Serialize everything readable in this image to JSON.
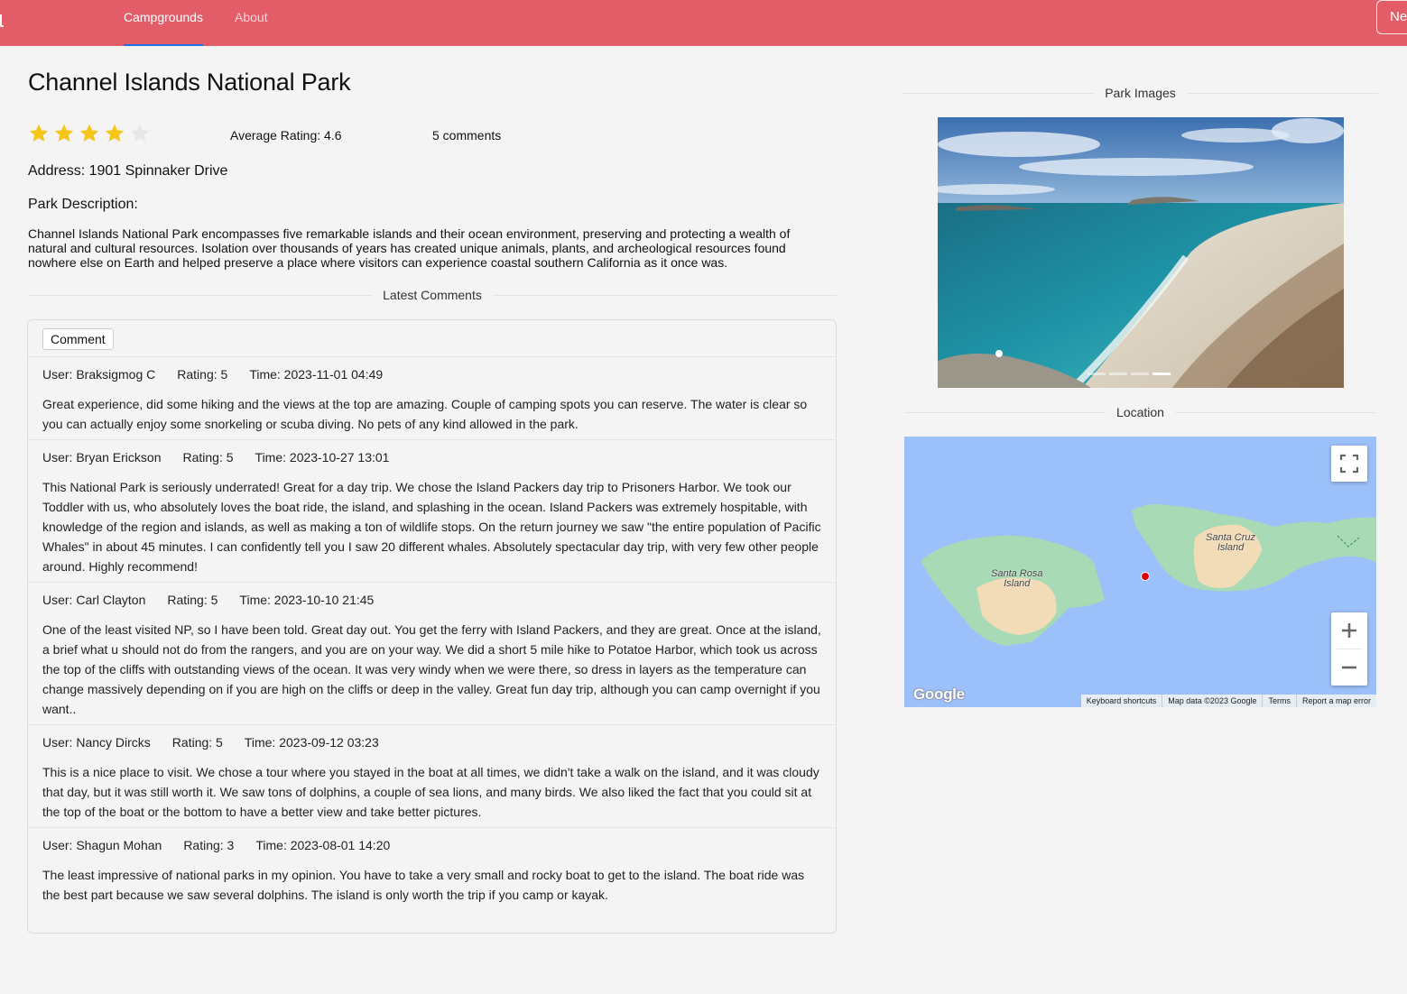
{
  "nav": {
    "tabs": [
      {
        "label": "Campgrounds",
        "active": true
      },
      {
        "label": "About",
        "active": false
      }
    ],
    "new_button": "Ne"
  },
  "park": {
    "title": "Channel Islands National Park",
    "rating_stars": {
      "filled": 4,
      "total": 5
    },
    "average_rating": "Average Rating: 4.6",
    "comment_count": "5 comments",
    "address": "Address: 1901 Spinnaker Drive",
    "description_heading": "Park Description:",
    "description": "Channel Islands National Park encompasses five remarkable islands and their ocean environment, preserving and protecting a wealth of natural and cultural resources. Isolation over thousands of years has created unique animals, plants, and archeological resources found nowhere else on Earth and helped preserve a place where visitors can experience coastal southern California as it once was."
  },
  "comments_section": {
    "heading": "Latest Comments",
    "comment_button": "Comment",
    "items": [
      {
        "user": "User: Braksigmog C",
        "rating": "Rating: 5",
        "time": "Time: 2023-11-01 04:49",
        "text": "Great experience, did some hiking and the views at the top are amazing. Couple of camping spots you can reserve. The water is clear so you can actually enjoy some snorkeling or scuba diving. No pets of any kind allowed in the park."
      },
      {
        "user": "User: Bryan Erickson",
        "rating": "Rating: 5",
        "time": "Time: 2023-10-27 13:01",
        "text": "This National Park is seriously underrated! Great for a day trip. We chose the Island Packers day trip to Prisoners Harbor. We took our Toddler with us, who absolutely loves the boat ride, the island, and splashing in the ocean. Island Packers was extremely hospitable, with knowledge of the region and islands, as well as making a ton of wildlife stops. On the return journey we saw \"the entire population of Pacific Whales\" in about 45 minutes. I can confidently tell you I saw 20 different whales. Absolutely spectacular day trip, with very few other people around. Highly recommend!"
      },
      {
        "user": "User: Carl Clayton",
        "rating": "Rating: 5",
        "time": "Time: 2023-10-10 21:45",
        "text": "One of the least visited NP, so I have been told. Great day out. You get the ferry with Island Packers, and they are great. Once at the island, a brief what u should not do from the rangers, and you are on your way. We did a short 5 mile hike to Potatoe Harbor, which took us across the top of the cliffs with outstanding views of the ocean. It was very windy when we were there, so dress in layers as the temperature can change massively depending on if you are high on the cliffs or deep in the valley. Great fun day trip, although you can camp overnight if you want.."
      },
      {
        "user": "User: Nancy Dircks",
        "rating": "Rating: 5",
        "time": "Time: 2023-09-12 03:23",
        "text": "This is a nice place to visit. We chose a tour where you stayed in the boat at all times, we didn't take a walk on the island, and it was cloudy that day, but it was still worth it. We saw tons of dolphins, a couple of sea lions, and many birds. We also liked the fact that you could sit at the top of the boat or the bottom to have a better view and take better pictures."
      },
      {
        "user": "User: Shagun Mohan",
        "rating": "Rating: 3",
        "time": "Time: 2023-08-01 14:20",
        "text": "The least impressive of national parks in my opinion. You have to take a very small and rocky boat to get to the island. The boat ride was the best part because we saw several dolphins. The island is only worth the trip if you camp or kayak."
      }
    ]
  },
  "images_section": {
    "heading": "Park Images",
    "slide_count": 4,
    "active_slide": 3
  },
  "location_section": {
    "heading": "Location",
    "map": {
      "labels": {
        "santa_rosa_1": "Santa Rosa",
        "santa_rosa_2": "Island",
        "santa_cruz_1": "Santa Cruz",
        "santa_cruz_2": "Island"
      },
      "logo": "Google",
      "footer": {
        "shortcuts": "Keyboard shortcuts",
        "data": "Map data ©2023 Google",
        "terms": "Terms",
        "report": "Report a map error"
      },
      "colors": {
        "water": "#9cc0f9",
        "land": "#a8dab5",
        "terrain": "#f2dcb8",
        "marker": "#e00000"
      }
    }
  },
  "colors": {
    "navbar": "#e35d68",
    "star_filled": "#f5c518",
    "star_empty": "#e6e6e6"
  }
}
